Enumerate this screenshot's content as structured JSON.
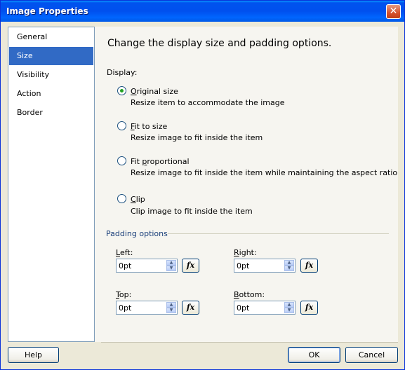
{
  "window": {
    "title": "Image Properties",
    "close_icon": "close-icon"
  },
  "nav": {
    "items": [
      {
        "label": "General"
      },
      {
        "label": "Size",
        "selected": true
      },
      {
        "label": "Visibility"
      },
      {
        "label": "Action"
      },
      {
        "label": "Border"
      }
    ]
  },
  "main": {
    "heading": "Change the display size and padding options.",
    "display_label": "Display:",
    "options": [
      {
        "title": "Original size",
        "mnemonic": "O",
        "rest": "riginal size",
        "desc": "Resize item to accommodate the image",
        "checked": true
      },
      {
        "title": "Fit to size",
        "mnemonic": "F",
        "rest": "it to size",
        "desc": "Resize image to fit inside the item",
        "checked": false
      },
      {
        "title": "Fit proportional",
        "pre": "Fit ",
        "mnemonic": "p",
        "rest": "roportional",
        "desc": "Resize image to fit inside the item while maintaining the aspect ratio",
        "checked": false
      },
      {
        "title": "Clip",
        "mnemonic": "C",
        "rest": "lip",
        "desc": "Clip image to fit inside the item",
        "checked": false
      }
    ],
    "padding_label": "Padding options",
    "padding": {
      "left": {
        "mnemonic": "L",
        "rest": "eft:",
        "value": "0pt"
      },
      "right": {
        "mnemonic": "R",
        "rest": "ight:",
        "value": "0pt"
      },
      "top": {
        "mnemonic": "T",
        "rest": "op:",
        "value": "0pt"
      },
      "bottom": {
        "mnemonic": "B",
        "rest": "ottom:",
        "value": "0pt"
      }
    },
    "fx_label": "fx"
  },
  "footer": {
    "help": "Help",
    "ok": "OK",
    "cancel": "Cancel"
  },
  "colors": {
    "titlebar": "#0053ee",
    "selection": "#316ac5",
    "radio_dot": "#21a121"
  }
}
